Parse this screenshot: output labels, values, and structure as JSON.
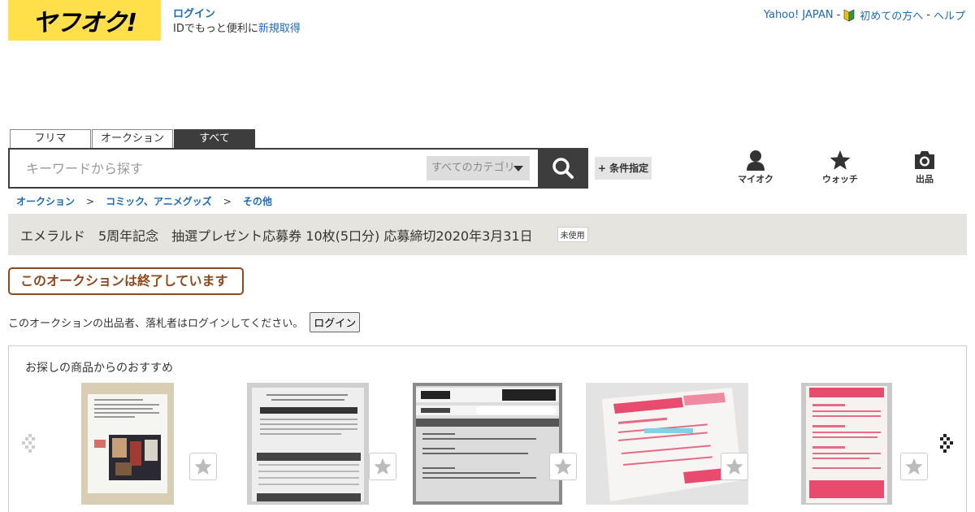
{
  "header": {
    "logo_text": "ヤフオク!",
    "login_label": "ログイン",
    "login_sub_prefix": "IDでもっと便利に",
    "register_label": "新規取得",
    "top_links": {
      "yahoo": "Yahoo! JAPAN",
      "sep1": "-",
      "beginner": "初めての方へ",
      "sep2": "-",
      "help": "ヘルプ"
    }
  },
  "search": {
    "tabs": [
      {
        "label": "フリマ",
        "active": false
      },
      {
        "label": "オークション",
        "active": false
      },
      {
        "label": "すべて",
        "active": true
      }
    ],
    "placeholder": "キーワードから探す",
    "category": "すべてのカテゴリ",
    "conditions_label": "+ 条件指定"
  },
  "nav": {
    "myauc": "マイオク",
    "watch": "ウォッチ",
    "sell": "出品"
  },
  "breadcrumb": [
    "オークション",
    "コミック、アニメグッズ",
    "その他"
  ],
  "breadcrumb_sep": ">",
  "item": {
    "title": "エメラルド　5周年記念　抽選プレゼント応募券 10枚(5口分) 応募締切2020年3月31日",
    "condition": "未使用"
  },
  "status": {
    "ended": "このオークションは終了しています",
    "notice": "このオークションの出品者、落札者はログインしてください。",
    "login_button": "ログイン"
  },
  "recommend": {
    "title": "お探しの商品からのおすすめ"
  },
  "colors": {
    "brand_yellow": "#ffe04b",
    "link_blue": "#1d6ab5",
    "ended_brown": "#8e4a1d",
    "dark": "#3d3d3d"
  }
}
